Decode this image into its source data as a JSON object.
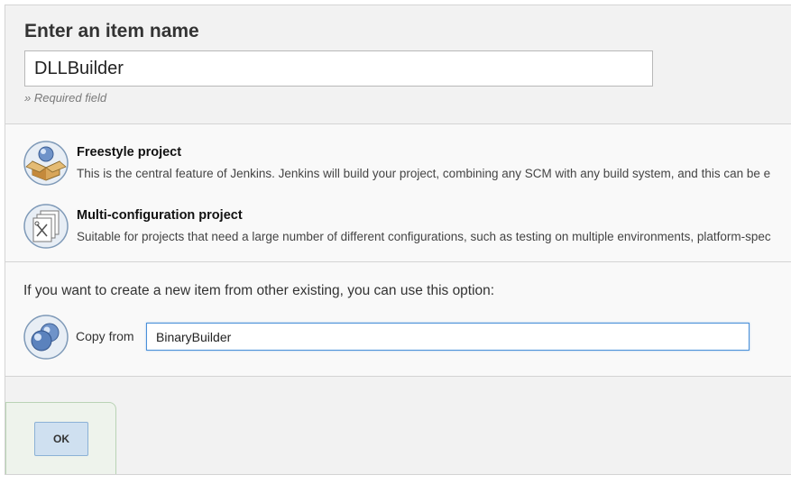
{
  "header": {
    "title": "Enter an item name",
    "item_name_value": "DLLBuilder",
    "required_note": "» Required field"
  },
  "item_types": [
    {
      "icon": "freestyle-project-icon",
      "title": "Freestyle project",
      "description": "This is the central feature of Jenkins. Jenkins will build your project, combining any SCM with any build system, and this can be e"
    },
    {
      "icon": "multi-configuration-project-icon",
      "title": "Multi-configuration project",
      "description": "Suitable for projects that need a large number of different configurations, such as testing on multiple environments, platform-spec"
    }
  ],
  "copy_section": {
    "hint": "If you want to create a new item from other existing, you can use this option:",
    "icon": "copy-item-icon",
    "label": "Copy from",
    "value": "BinaryBuilder"
  },
  "footer": {
    "ok_label": "OK"
  },
  "colors": {
    "background": "#f2f2f2",
    "panel": "#f9f9f9",
    "button": "#cfe0f0",
    "focus_border": "#4a90d9"
  }
}
